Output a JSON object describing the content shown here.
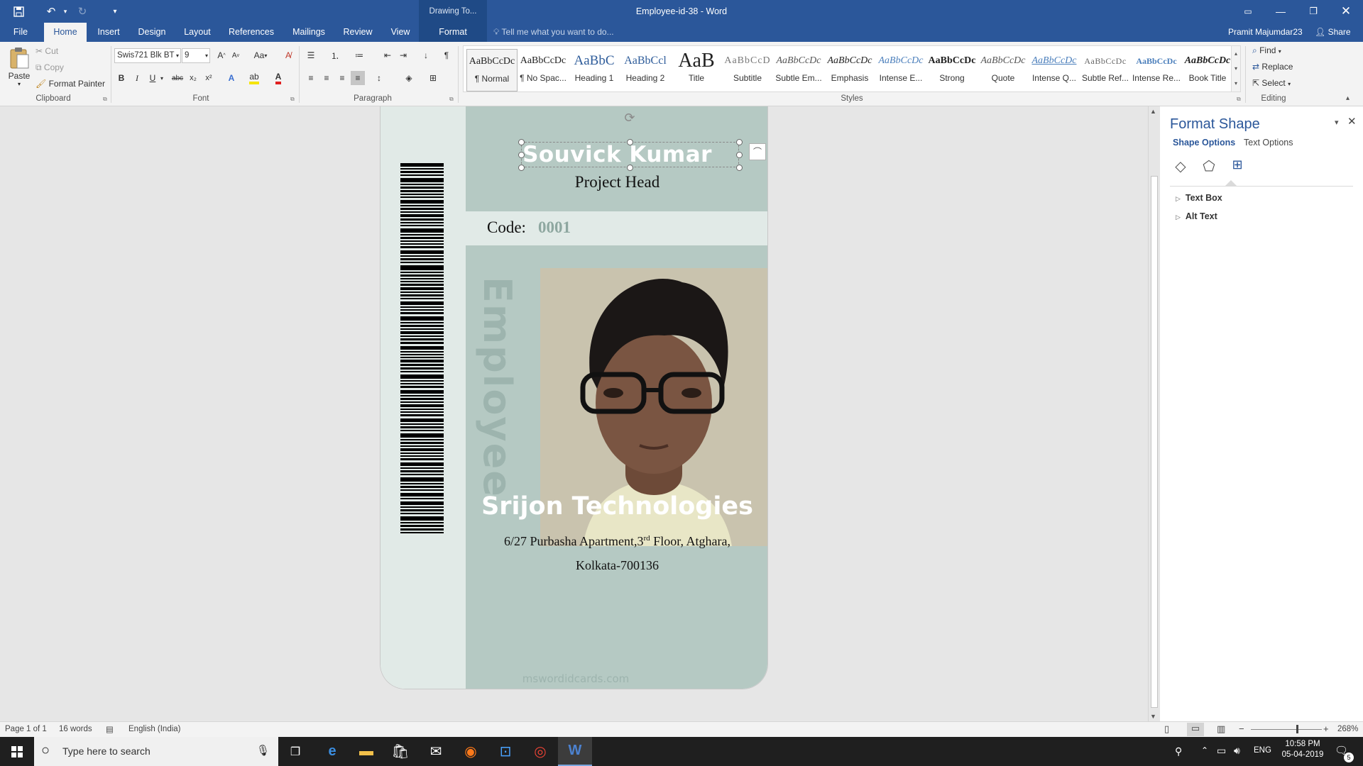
{
  "window": {
    "title": "Employee-id-38 - Word",
    "context_tab_group": "Drawing To...",
    "user": "Pramit Majumdar23",
    "share_label": "Share"
  },
  "tabs": [
    {
      "label": "File"
    },
    {
      "label": "Home"
    },
    {
      "label": "Insert"
    },
    {
      "label": "Design"
    },
    {
      "label": "Layout"
    },
    {
      "label": "References"
    },
    {
      "label": "Mailings"
    },
    {
      "label": "Review"
    },
    {
      "label": "View"
    },
    {
      "label": "Format"
    }
  ],
  "tell_me": "Tell me what you want to do...",
  "clipboard": {
    "paste": "Paste",
    "cut": "Cut",
    "copy": "Copy",
    "format_painter": "Format Painter",
    "group": "Clipboard"
  },
  "font": {
    "name": "Swis721 Blk BT",
    "size": "9",
    "group": "Font",
    "bold": "B",
    "italic": "I",
    "underline": "U",
    "strike": "abc",
    "sub": "x₂",
    "sup": "x²",
    "case": "Aa"
  },
  "paragraph": {
    "group": "Paragraph"
  },
  "styles": {
    "group": "Styles",
    "items": [
      {
        "preview": "AaBbCcDc",
        "name": "¶ Normal"
      },
      {
        "preview": "AaBbCcDc",
        "name": "¶ No Spac..."
      },
      {
        "preview": "AaBbC",
        "name": "Heading 1"
      },
      {
        "preview": "AaBbCcl",
        "name": "Heading 2"
      },
      {
        "preview": "AaB",
        "name": "Title"
      },
      {
        "preview": "AaBbCcD",
        "name": "Subtitle"
      },
      {
        "preview": "AaBbCcDc",
        "name": "Subtle Em..."
      },
      {
        "preview": "AaBbCcDc",
        "name": "Emphasis"
      },
      {
        "preview": "AaBbCcDc",
        "name": "Intense E..."
      },
      {
        "preview": "AaBbCcDc",
        "name": "Strong"
      },
      {
        "preview": "AaBbCcDc",
        "name": "Quote"
      },
      {
        "preview": "AaBbCcDc",
        "name": "Intense Q..."
      },
      {
        "preview": "AaBbCcDc",
        "name": "Subtle Ref..."
      },
      {
        "preview": "AaBbCcDc",
        "name": "Intense Re..."
      },
      {
        "preview": "AaBbCcDc",
        "name": "Book Title"
      }
    ]
  },
  "editing": {
    "find": "Find",
    "replace": "Replace",
    "select": "Select",
    "group": "Editing"
  },
  "card": {
    "name": "Souvick Kumar",
    "designation": "Project Head",
    "code_label": "Code:",
    "code_value": "0001",
    "vertical_text": "Employee",
    "company": "Srijon Technologies",
    "address_line1": "6/27 Purbasha Apartment,3",
    "address_sup": "rd",
    "address_line1b": " Floor, Atghara,",
    "address_line2": "Kolkata-700136",
    "watermark": "mswordidcards.com"
  },
  "pane": {
    "title": "Format Shape",
    "tab1": "Shape Options",
    "tab2": "Text Options",
    "section1": "Text Box",
    "section2": "Alt Text"
  },
  "status": {
    "page": "Page 1 of 1",
    "words": "16 words",
    "language": "English (India)",
    "zoom": "268%"
  },
  "taskbar": {
    "search": "Type here to search",
    "lang": "ENG",
    "time": "10:58 PM",
    "date": "05-04-2019",
    "notif": "5"
  },
  "colors": {
    "accent": "#2b579a",
    "card_teal": "#b5c9c3",
    "card_light": "#e1eae7",
    "code_value": "#8ea7a0"
  }
}
